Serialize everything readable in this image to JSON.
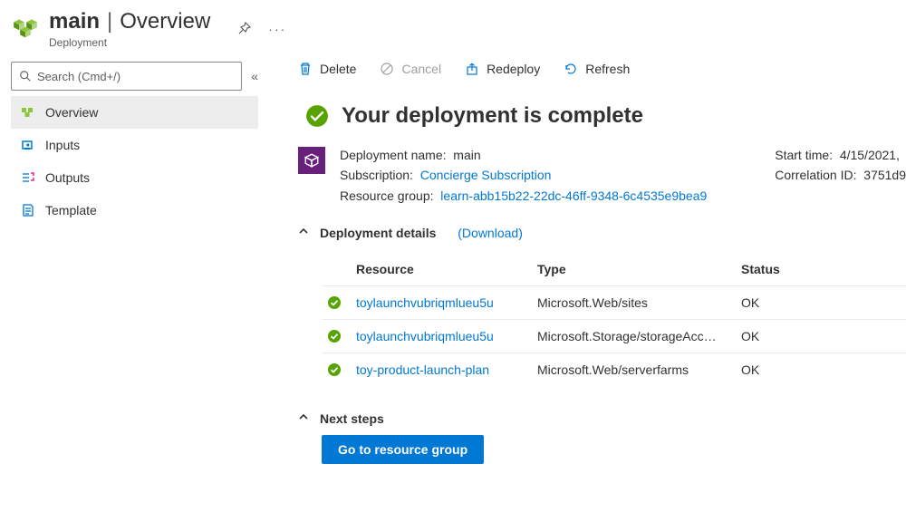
{
  "header": {
    "name": "main",
    "separator": "|",
    "view": "Overview",
    "subtitle": "Deployment"
  },
  "sidebar": {
    "search_placeholder": "Search (Cmd+/)",
    "items": [
      {
        "label": "Overview"
      },
      {
        "label": "Inputs"
      },
      {
        "label": "Outputs"
      },
      {
        "label": "Template"
      }
    ]
  },
  "toolbar": {
    "delete": "Delete",
    "cancel": "Cancel",
    "redeploy": "Redeploy",
    "refresh": "Refresh"
  },
  "status": {
    "title": "Your deployment is complete"
  },
  "meta": {
    "deployment_name_label": "Deployment name:",
    "deployment_name": "main",
    "subscription_label": "Subscription:",
    "subscription": "Concierge Subscription",
    "resource_group_label": "Resource group:",
    "resource_group": "learn-abb15b22-22dc-46ff-9348-6c4535e9bea9",
    "start_time_label": "Start time:",
    "start_time": "4/15/2021,",
    "correlation_label": "Correlation ID:",
    "correlation_id": "3751d9"
  },
  "details": {
    "title": "Deployment details",
    "download": "(Download)",
    "columns": {
      "resource": "Resource",
      "type": "Type",
      "status": "Status"
    },
    "rows": [
      {
        "resource": "toylaunchvubriqmlueu5u",
        "type": "Microsoft.Web/sites",
        "status": "OK"
      },
      {
        "resource": "toylaunchvubriqmlueu5u",
        "type": "Microsoft.Storage/storageAcc…",
        "status": "OK"
      },
      {
        "resource": "toy-product-launch-plan",
        "type": "Microsoft.Web/serverfarms",
        "status": "OK"
      }
    ]
  },
  "next": {
    "title": "Next steps",
    "go_button": "Go to resource group"
  }
}
